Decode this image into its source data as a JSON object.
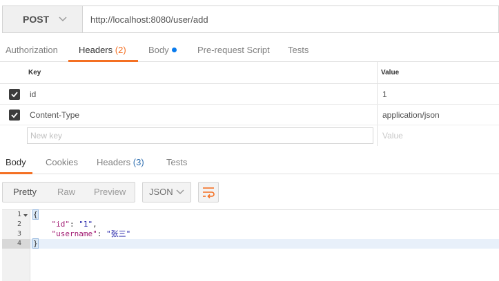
{
  "request": {
    "method": "POST",
    "url": "http://localhost:8080/user/add"
  },
  "request_tabs": [
    {
      "label": "Authorization"
    },
    {
      "label": "Headers",
      "count": "(2)"
    },
    {
      "label": "Body"
    },
    {
      "label": "Pre-request Script"
    },
    {
      "label": "Tests"
    }
  ],
  "headers_table": {
    "key_header": "Key",
    "value_header": "Value",
    "rows": [
      {
        "key": "id",
        "value": "1",
        "checked": true
      },
      {
        "key": "Content-Type",
        "value": "application/json",
        "checked": true
      }
    ],
    "new_key_placeholder": "New key",
    "new_value_placeholder": "Value"
  },
  "response_tabs": [
    {
      "label": "Body"
    },
    {
      "label": "Cookies"
    },
    {
      "label": "Headers",
      "count": "(3)"
    },
    {
      "label": "Tests"
    }
  ],
  "response_toolbar": {
    "view_modes": [
      "Pretty",
      "Raw",
      "Preview"
    ],
    "format": "JSON"
  },
  "editor": {
    "line_numbers": [
      "1",
      "2",
      "3",
      "4"
    ],
    "lines": {
      "open": "{",
      "l2_key": "\"id\"",
      "l2_sep": ": ",
      "l2_val": "\"1\"",
      "l2_end": ",",
      "l3_key": "\"username\"",
      "l3_sep": ": ",
      "l3_val": "\"张三\"",
      "close": "}"
    }
  },
  "colors": {
    "accent": "#f47023",
    "body_dot": "#097bed"
  }
}
